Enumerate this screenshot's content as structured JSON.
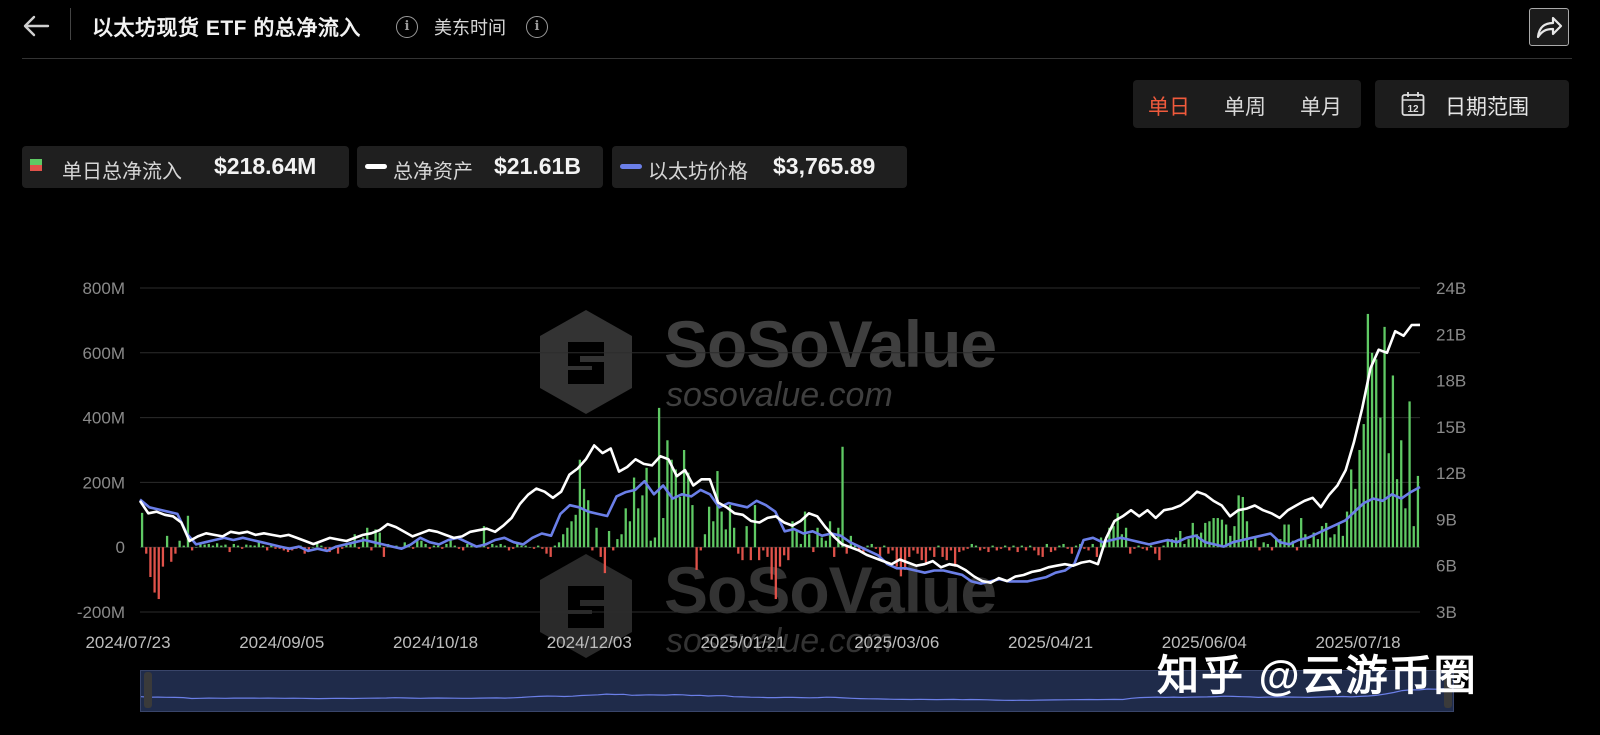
{
  "header": {
    "title": "以太坊现货 ETF 的总净流入",
    "timezone": "美东时间"
  },
  "period_tabs": [
    {
      "label": "单日",
      "active": true
    },
    {
      "label": "单周",
      "active": false
    },
    {
      "label": "单月",
      "active": false
    }
  ],
  "date_range": {
    "label": "日期范围",
    "icon_day": "12"
  },
  "legend": {
    "daily": {
      "label": "单日总净流入",
      "value": "$218.64M"
    },
    "assets": {
      "label": "总净资产",
      "value": "$21.61B"
    },
    "price": {
      "label": "以太坊价格",
      "value": "$3,765.89"
    }
  },
  "watermark": {
    "brand": "SoSoValue",
    "url": "sosovalue.com"
  },
  "overlay_text": "知乎 @云游币圈",
  "colors": {
    "positive": "#5fc964",
    "negative": "#e0524a",
    "assets_line": "#ffffff",
    "price_line": "#6b7fe8",
    "accent": "#f05a3c"
  },
  "chart_data": {
    "type": "bar",
    "title": "",
    "x_ticks": [
      "2024/07/23",
      "2024/09/05",
      "2024/10/18",
      "2024/12/03",
      "2025/01/21",
      "2025/03/06",
      "2025/04/21",
      "2025/06/04",
      "2025/07/18"
    ],
    "y_left": {
      "ticks": [
        "800M",
        "600M",
        "400M",
        "200M",
        "0",
        "-200M"
      ],
      "range_millions": [
        -200,
        800
      ]
    },
    "y_right": {
      "ticks": [
        "24B",
        "21B",
        "18B",
        "15B",
        "12B",
        "9B",
        "6B",
        "3B"
      ],
      "range_billions": [
        3,
        24
      ]
    },
    "series": [
      {
        "name": "单日总净流入",
        "type": "bar",
        "unit": "M USD",
        "values": [
          106,
          -20,
          -92,
          -140,
          -160,
          -60,
          35,
          -45,
          -20,
          20,
          5,
          97,
          -10,
          0,
          10,
          8,
          10,
          5,
          12,
          5,
          8,
          -15,
          10,
          5,
          -5,
          8,
          6,
          5,
          15,
          5,
          -10,
          10,
          -5,
          -5,
          -10,
          -15,
          -10,
          -5,
          5,
          -20,
          -10,
          0,
          15,
          5,
          -10,
          -15,
          -5,
          -20,
          -5,
          10,
          10,
          40,
          -5,
          30,
          60,
          -10,
          55,
          45,
          -30,
          10,
          5,
          5,
          -5,
          15,
          5,
          -5,
          25,
          20,
          10,
          -5,
          5,
          5,
          -5,
          10,
          25,
          5,
          -5,
          -10,
          10,
          5,
          5,
          5,
          65,
          -5,
          10,
          5,
          10,
          5,
          -10,
          -5,
          10,
          5,
          5,
          0,
          -5,
          5,
          -5,
          -20,
          -30,
          5,
          15,
          40,
          60,
          80,
          100,
          270,
          180,
          145,
          -10,
          60,
          -30,
          -80,
          50,
          -10,
          25,
          40,
          120,
          80,
          215,
          120,
          160,
          245,
          20,
          30,
          430,
          90,
          330,
          270,
          240,
          155,
          300,
          230,
          130,
          -70,
          -10,
          40,
          125,
          80,
          235,
          110,
          55,
          130,
          60,
          -20,
          -40,
          65,
          -40,
          130,
          -40,
          -10,
          -30,
          -100,
          -160,
          -60,
          -25,
          -40,
          80,
          50,
          10,
          110,
          40,
          -15,
          60,
          30,
          20,
          80,
          -30,
          60,
          310,
          -20,
          35,
          10,
          -10,
          -20,
          5,
          10,
          -5,
          -30,
          5,
          -20,
          -10,
          -60,
          -90,
          -70,
          -30,
          -10,
          -20,
          -40,
          -55,
          -10,
          -30,
          5,
          -30,
          -40,
          -10,
          -60,
          -15,
          -10,
          -5,
          10,
          5,
          -10,
          -5,
          -15,
          5,
          -10,
          -5,
          5,
          -10,
          5,
          -15,
          5,
          -10,
          5,
          -10,
          -25,
          -30,
          10,
          -15,
          -10,
          5,
          10,
          -5,
          -20,
          5,
          10,
          -5,
          -10,
          10,
          -30,
          30,
          25,
          60,
          65,
          105,
          40,
          60,
          -20,
          -5,
          5,
          -5,
          -10,
          5,
          -20,
          -40,
          5,
          20,
          25,
          30,
          50,
          10,
          25,
          75,
          40,
          45,
          75,
          80,
          90,
          90,
          85,
          70,
          35,
          65,
          160,
          155,
          80,
          20,
          30,
          -10,
          15,
          10,
          -10,
          25,
          25,
          70,
          70,
          20,
          -10,
          90,
          40,
          10,
          45,
          25,
          65,
          75,
          30,
          40,
          75,
          35,
          110,
          240,
          180,
          300,
          380,
          720,
          600,
          580,
          400,
          680,
          290,
          530,
          210,
          330,
          120,
          450,
          65,
          220
        ]
      },
      {
        "name": "总净资产",
        "type": "line",
        "unit": "B USD",
        "values": [
          10.2,
          9.4,
          9.5,
          9.3,
          9.2,
          8.8,
          7.6,
          7.9,
          8.1,
          8.0,
          7.9,
          8.2,
          8.1,
          8.2,
          8.0,
          8.1,
          8.0,
          7.9,
          8.0,
          7.8,
          7.6,
          7.4,
          7.6,
          7.8,
          7.7,
          7.6,
          7.8,
          8.0,
          8.1,
          8.3,
          8.7,
          8.5,
          8.2,
          7.9,
          8.1,
          8.3,
          8.2,
          8.0,
          7.8,
          7.9,
          8.2,
          8.3,
          8.4,
          8.2,
          8.6,
          9.1,
          10.0,
          10.6,
          11.0,
          10.8,
          10.4,
          10.8,
          11.9,
          12.3,
          12.9,
          13.8,
          13.3,
          13.6,
          12.1,
          12.4,
          12.9,
          12.6,
          12.5,
          13.1,
          12.9,
          11.8,
          12.2,
          11.2,
          11.6,
          11.6,
          10.1,
          9.8,
          9.4,
          9.3,
          8.9,
          8.8,
          9.1,
          9.2,
          8.8,
          8.6,
          8.9,
          9.4,
          9.2,
          8.5,
          7.9,
          7.4,
          7.2,
          7.0,
          6.7,
          6.5,
          6.3,
          6.1,
          6.4,
          6.2,
          6.0,
          6.1,
          6.3,
          5.9,
          6.1,
          6.0,
          5.7,
          5.3,
          5.0,
          4.9,
          5.2,
          5.0,
          5.3,
          5.4,
          5.6,
          5.7,
          5.9,
          6.0,
          6.1,
          6.0,
          6.2,
          6.3,
          6.1,
          7.8,
          8.9,
          9.2,
          9.6,
          9.2,
          9.6,
          9.1,
          9.6,
          9.7,
          9.9,
          10.3,
          10.8,
          10.6,
          10.2,
          9.9,
          9.2,
          9.6,
          9.7,
          9.9,
          9.6,
          9.4,
          9.1,
          9.6,
          9.9,
          10.2,
          10.4,
          9.8,
          10.6,
          11.2,
          12.2,
          14.0,
          16.2,
          18.8,
          20.0,
          19.8,
          21.2,
          20.9,
          21.6,
          21.61
        ]
      },
      {
        "name": "以太坊价格",
        "type": "line",
        "unit": "USD",
        "values": [
          3480,
          3300,
          3250,
          3200,
          3150,
          2700,
          2450,
          2500,
          2550,
          2600,
          2550,
          2600,
          2550,
          2500,
          2450,
          2400,
          2350,
          2400,
          2300,
          2350,
          2300,
          2400,
          2450,
          2500,
          2550,
          2500,
          2450,
          2400,
          2350,
          2450,
          2600,
          2500,
          2450,
          2550,
          2600,
          2500,
          2400,
          2450,
          2550,
          2600,
          2500,
          2450,
          2600,
          2700,
          2650,
          3150,
          3350,
          3300,
          3200,
          3150,
          3100,
          3550,
          3650,
          3700,
          3900,
          3600,
          3800,
          3500,
          3600,
          3550,
          3700,
          3600,
          3300,
          3400,
          3350,
          3300,
          3450,
          3350,
          3200,
          2750,
          2800,
          2700,
          2750,
          2650,
          2700,
          2650,
          2500,
          2400,
          2300,
          2200,
          2000,
          1900,
          1900,
          1850,
          1800,
          1850,
          1850,
          1800,
          1750,
          1600,
          1550,
          1600,
          1650,
          1600,
          1600,
          1600,
          1650,
          1700,
          1800,
          1850,
          2000,
          2550,
          2600,
          2500,
          2550,
          2600,
          2550,
          2500,
          2450,
          2500,
          2550,
          2500,
          2600,
          2650,
          2500,
          2450,
          2400,
          2500,
          2550,
          2600,
          2650,
          2700,
          2500,
          2450,
          2550,
          2600,
          2700,
          2800,
          2900,
          3000,
          3200,
          3400,
          3500,
          3450,
          3600,
          3500,
          3650,
          3765.89
        ]
      }
    ]
  }
}
